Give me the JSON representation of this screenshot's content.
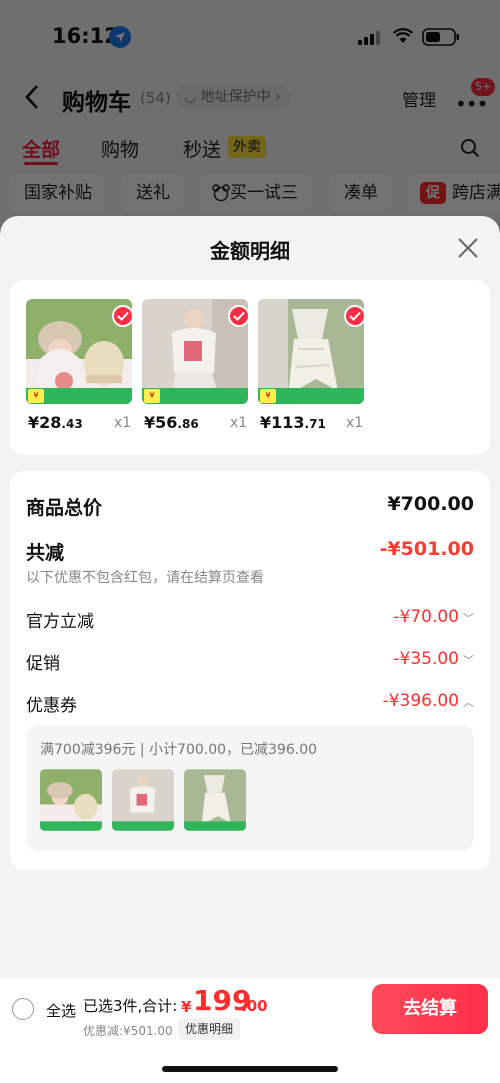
{
  "status_bar": {
    "time": "16:12"
  },
  "header": {
    "title": "购物车",
    "count": "(54)",
    "address_protect": "地址保护中",
    "manage": "管理",
    "more": "•••",
    "msg_badge": "5+"
  },
  "tabs": [
    {
      "label": "全部"
    },
    {
      "label": "购物"
    },
    {
      "label": "秒送"
    }
  ],
  "waimai_badge": "外卖",
  "chips": {
    "guojia": "国家补贴",
    "songli": "送礼",
    "maiyi": "买一试三",
    "coudan": "凑单",
    "promo_icon": "促",
    "kuadian": "跨店满"
  },
  "sheet": {
    "title": "金额明细",
    "items": [
      {
        "price_int": "¥28",
        "price_dec": ".43",
        "qty": "x1"
      },
      {
        "price_int": "¥56",
        "price_dec": ".86",
        "qty": "x1"
      },
      {
        "price_int": "¥113",
        "price_dec": ".71",
        "qty": "x1"
      }
    ],
    "total_label": "商品总价",
    "total_value": "¥700.00",
    "reduce_label": "共减",
    "reduce_value": "-¥501.00",
    "note": "以下优惠不包含红包，请在结算页查看",
    "official_label": "官方立减",
    "official_value": "-¥70.00",
    "promo_label": "促销",
    "promo_value": "-¥35.00",
    "coupon_label": "优惠券",
    "coupon_value": "-¥396.00",
    "coupon_detail": "满700减396元 | 小计700.00，已减396.00"
  },
  "bottom": {
    "select_all": "全选",
    "summary": "已选3件,合计:",
    "total_yen": "¥",
    "total_int": "199",
    "total_dec": ".00",
    "discount": "优惠减:¥501.00",
    "detail": "优惠明细",
    "checkout": "去结算"
  },
  "colors": {
    "accent": "#ff2d46",
    "price_red": "#ff2d2d"
  }
}
